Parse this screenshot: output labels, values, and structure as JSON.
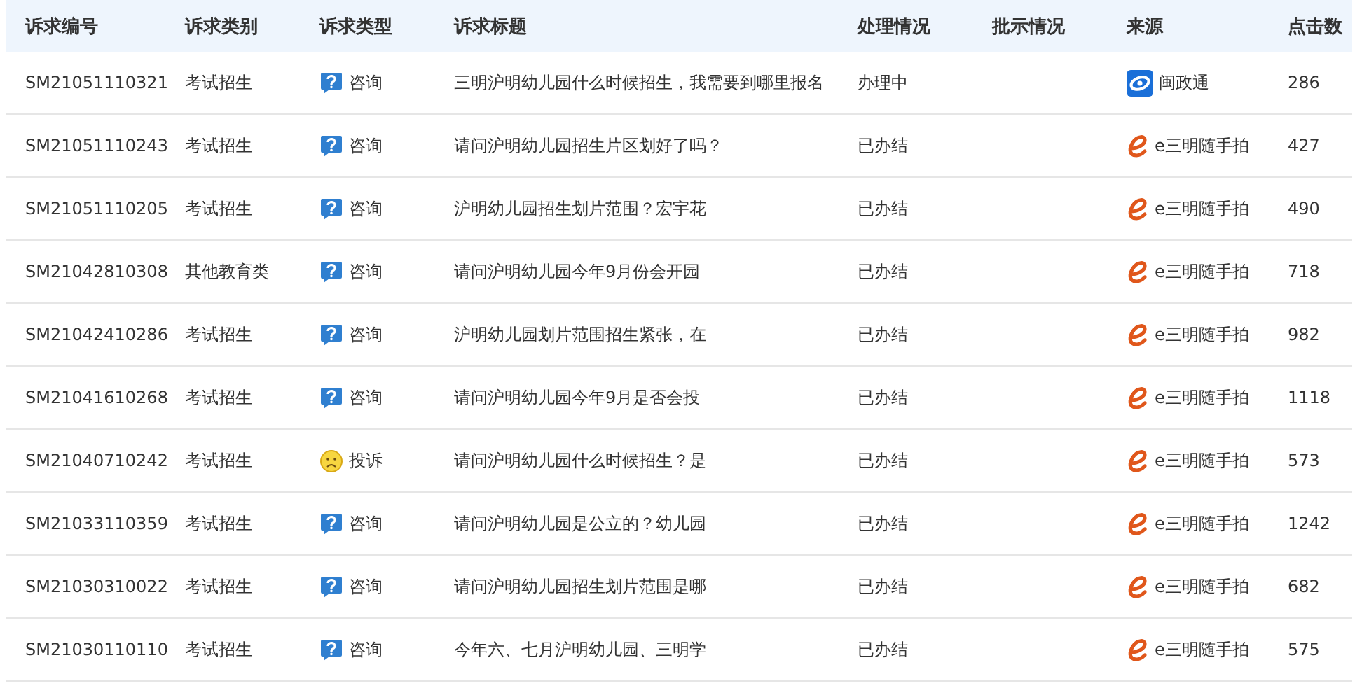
{
  "table": {
    "columns": [
      "诉求编号",
      "诉求类别",
      "诉求类型",
      "诉求标题",
      "处理情况",
      "批示情况",
      "来源",
      "点击数"
    ],
    "rows": [
      {
        "id": "SM21051110321",
        "category": "考试招生",
        "type": {
          "kind": "consult",
          "label": "咨询"
        },
        "title": "三明沪明幼儿园什么时候招生，我需要到哪里报名",
        "status": "办理中",
        "source": {
          "kind": "mzt",
          "label": "闽政通"
        },
        "clicks": "286"
      },
      {
        "id": "SM21051110243",
        "category": "考试招生",
        "type": {
          "kind": "consult",
          "label": "咨询"
        },
        "title": "请问沪明幼儿园招生片区划好了吗？",
        "status": "已办结",
        "source": {
          "kind": "e",
          "label": "e三明随手拍"
        },
        "clicks": "427"
      },
      {
        "id": "SM21051110205",
        "category": "考试招生",
        "type": {
          "kind": "consult",
          "label": "咨询"
        },
        "title": "沪明幼儿园招生划片范围？宏宇花",
        "status": "已办结",
        "source": {
          "kind": "e",
          "label": "e三明随手拍"
        },
        "clicks": "490"
      },
      {
        "id": "SM21042810308",
        "category": "其他教育类",
        "type": {
          "kind": "consult",
          "label": "咨询"
        },
        "title": "请问沪明幼儿园今年9月份会开园",
        "status": "已办结",
        "source": {
          "kind": "e",
          "label": "e三明随手拍"
        },
        "clicks": "718"
      },
      {
        "id": "SM21042410286",
        "category": "考试招生",
        "type": {
          "kind": "consult",
          "label": "咨询"
        },
        "title": "沪明幼儿园划片范围招生紧张，在",
        "status": "已办结",
        "source": {
          "kind": "e",
          "label": "e三明随手拍"
        },
        "clicks": "982"
      },
      {
        "id": "SM21041610268",
        "category": "考试招生",
        "type": {
          "kind": "consult",
          "label": "咨询"
        },
        "title": "请问沪明幼儿园今年9月是否会投",
        "status": "已办结",
        "source": {
          "kind": "e",
          "label": "e三明随手拍"
        },
        "clicks": "1118"
      },
      {
        "id": "SM21040710242",
        "category": "考试招生",
        "type": {
          "kind": "complaint",
          "label": "投诉"
        },
        "title": "请问沪明幼儿园什么时候招生？是",
        "status": "已办结",
        "source": {
          "kind": "e",
          "label": "e三明随手拍"
        },
        "clicks": "573"
      },
      {
        "id": "SM21033110359",
        "category": "考试招生",
        "type": {
          "kind": "consult",
          "label": "咨询"
        },
        "title": "请问沪明幼儿园是公立的？幼儿园",
        "status": "已办结",
        "source": {
          "kind": "e",
          "label": "e三明随手拍"
        },
        "clicks": "1242"
      },
      {
        "id": "SM21030310022",
        "category": "考试招生",
        "type": {
          "kind": "consult",
          "label": "咨询"
        },
        "title": "请问沪明幼儿园招生划片范围是哪",
        "status": "已办结",
        "source": {
          "kind": "e",
          "label": "e三明随手拍"
        },
        "clicks": "682"
      },
      {
        "id": "SM21030110110",
        "category": "考试招生",
        "type": {
          "kind": "consult",
          "label": "咨询"
        },
        "title": "今年六、七月沪明幼儿园、三明学",
        "status": "已办结",
        "source": {
          "kind": "e",
          "label": "e三明随手拍"
        },
        "clicks": "575"
      }
    ]
  }
}
